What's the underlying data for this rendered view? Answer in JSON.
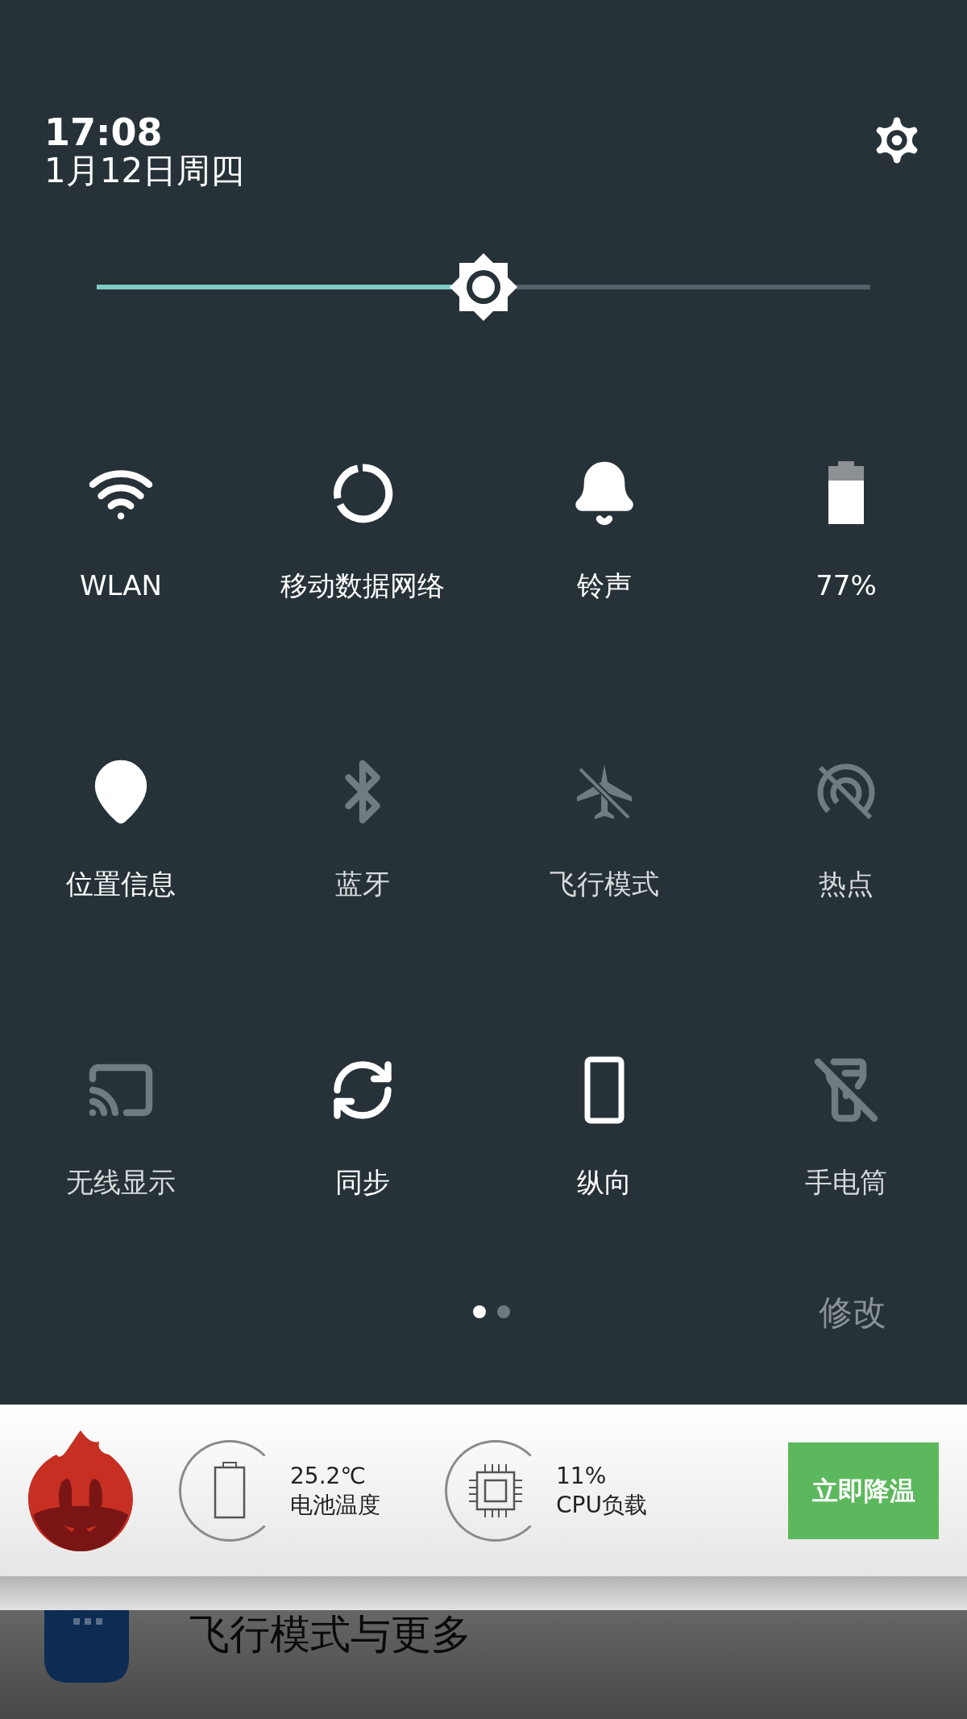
{
  "header": {
    "time": "17:08",
    "date": "1月12日周四"
  },
  "brightness": {
    "level": 0.5
  },
  "tiles": [
    {
      "kind": "wifi",
      "label": "WLAN",
      "on": true
    },
    {
      "kind": "data",
      "label": "移动数据网络",
      "on": true
    },
    {
      "kind": "bell",
      "label": "铃声",
      "on": true
    },
    {
      "kind": "battery",
      "label": "77%",
      "on": true
    },
    {
      "kind": "location",
      "label": "位置信息",
      "on": true
    },
    {
      "kind": "bluetooth",
      "label": "蓝牙",
      "on": false
    },
    {
      "kind": "airplane",
      "label": "飞行模式",
      "on": false
    },
    {
      "kind": "hotspot",
      "label": "热点",
      "on": false
    },
    {
      "kind": "cast",
      "label": "无线显示",
      "on": false
    },
    {
      "kind": "sync",
      "label": "同步",
      "on": true
    },
    {
      "kind": "portrait",
      "label": "纵向",
      "on": true
    },
    {
      "kind": "flashlight",
      "label": "手电筒",
      "on": false
    }
  ],
  "pages": [
    {
      "selected": true
    },
    {
      "selected": false
    }
  ],
  "edit_label": "修改",
  "notification": {
    "stats": [
      {
        "kind": "battery",
        "value": "25.2℃",
        "label": "电池温度"
      },
      {
        "kind": "cpu",
        "value": "11%",
        "label": "CPU负载"
      }
    ],
    "button": "立即降温"
  },
  "below": {
    "label": "飞行模式与更多"
  }
}
